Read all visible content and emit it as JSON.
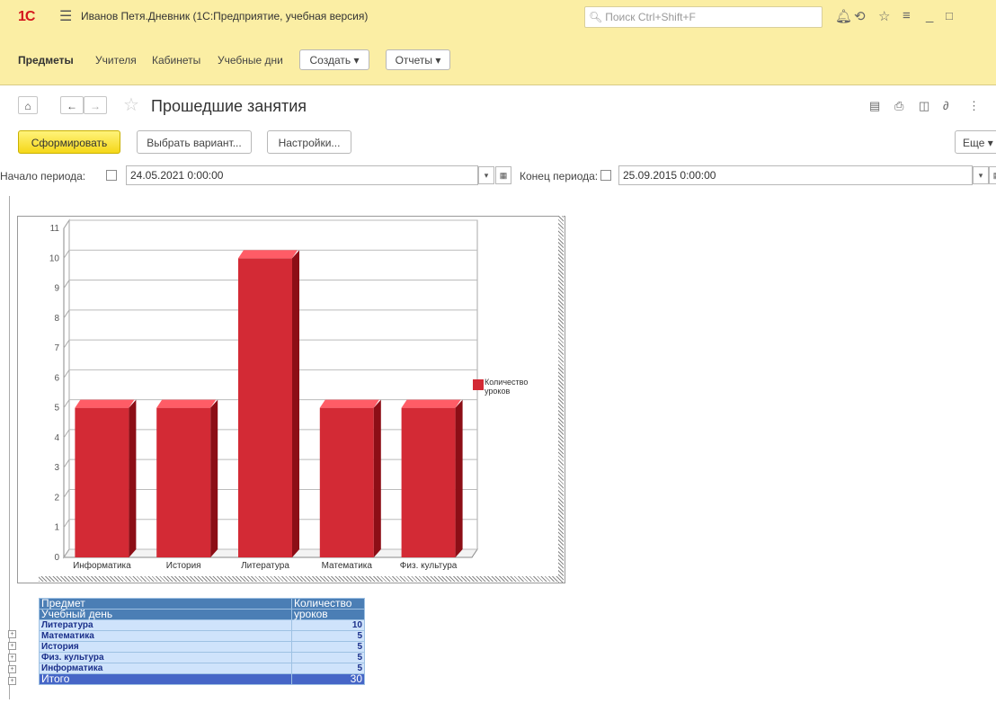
{
  "app": {
    "logo": "1С",
    "window_title": "Иванов Петя.Дневник  (1С:Предприятие, учебная версия)",
    "search_placeholder": "Поиск Ctrl+Shift+F"
  },
  "nav": {
    "items": [
      "Предметы",
      "Учителя",
      "Кабинеты",
      "Учебные дни"
    ],
    "create_label": "Создать",
    "reports_label": "Отчеты"
  },
  "form": {
    "title": "Прошедшие занятия",
    "generate_label": "Сформировать",
    "variant_label": "Выбрать вариант...",
    "settings_label": "Настройки...",
    "more_label": "Еще",
    "period_start_label": "Начало периода:",
    "period_start_value": "24.05.2021  0:00:00",
    "period_end_label": "Конец периода:",
    "period_end_value": "25.09.2015  0:00:00"
  },
  "chart_data": {
    "type": "bar",
    "categories": [
      "Информатика",
      "История",
      "Литература",
      "Математика",
      "Физ. культура"
    ],
    "series": [
      {
        "name": "Количество уроков",
        "values": [
          5,
          5,
          10,
          5,
          5
        ],
        "color": "#d32a35"
      }
    ],
    "ylim": [
      0,
      11
    ],
    "yticks": [
      0,
      1,
      2,
      3,
      4,
      5,
      6,
      7,
      8,
      9,
      10,
      11
    ],
    "legend_placement": "right",
    "grid": true
  },
  "table": {
    "header1": [
      "Предмет",
      "Количество"
    ],
    "header2": [
      "Учебный день",
      "уроков"
    ],
    "rows": [
      {
        "name": "Литература",
        "value": "10"
      },
      {
        "name": "Математика",
        "value": "5"
      },
      {
        "name": "История",
        "value": "5"
      },
      {
        "name": "Физ. культура",
        "value": "5"
      },
      {
        "name": "Информатика",
        "value": "5"
      }
    ],
    "total_label": "Итого",
    "total_value": "30"
  }
}
